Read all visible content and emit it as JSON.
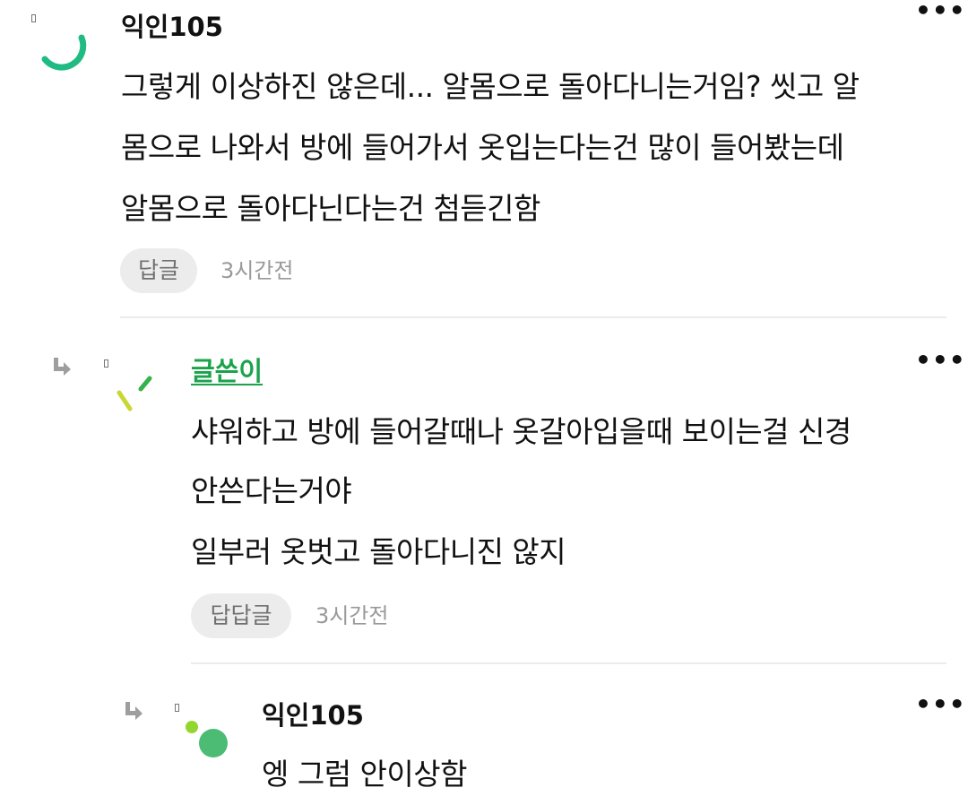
{
  "comments": [
    {
      "author": "익인105",
      "lines": [
        "그렇게 이상하진 않은데... 알몸으로 돌아다니는거임? 씻고 알",
        "몸으로 나와서 방에 들어가서 옷입는다는건 많이 들어봤는데",
        "알몸으로 돌아다닌다는건 첨듣긴함"
      ],
      "reply_label": "답글",
      "time": "3시간전"
    },
    {
      "author": "글쓴이",
      "lines": [
        "샤워하고 방에 들어갈때나 옷갈아입을때 보이는걸 신경",
        "안쓴다는거야",
        "일부러 옷벗고 돌아다니진 않지"
      ],
      "reply_label": "답답글",
      "time": "3시간전"
    },
    {
      "author": "익인105",
      "lines": [
        "엥 그럼 안이상함"
      ]
    }
  ],
  "more_label": "•••",
  "colors": {
    "op_author": "#1aa34a",
    "button_bg": "#ececec",
    "time": "#9a9a9a"
  }
}
